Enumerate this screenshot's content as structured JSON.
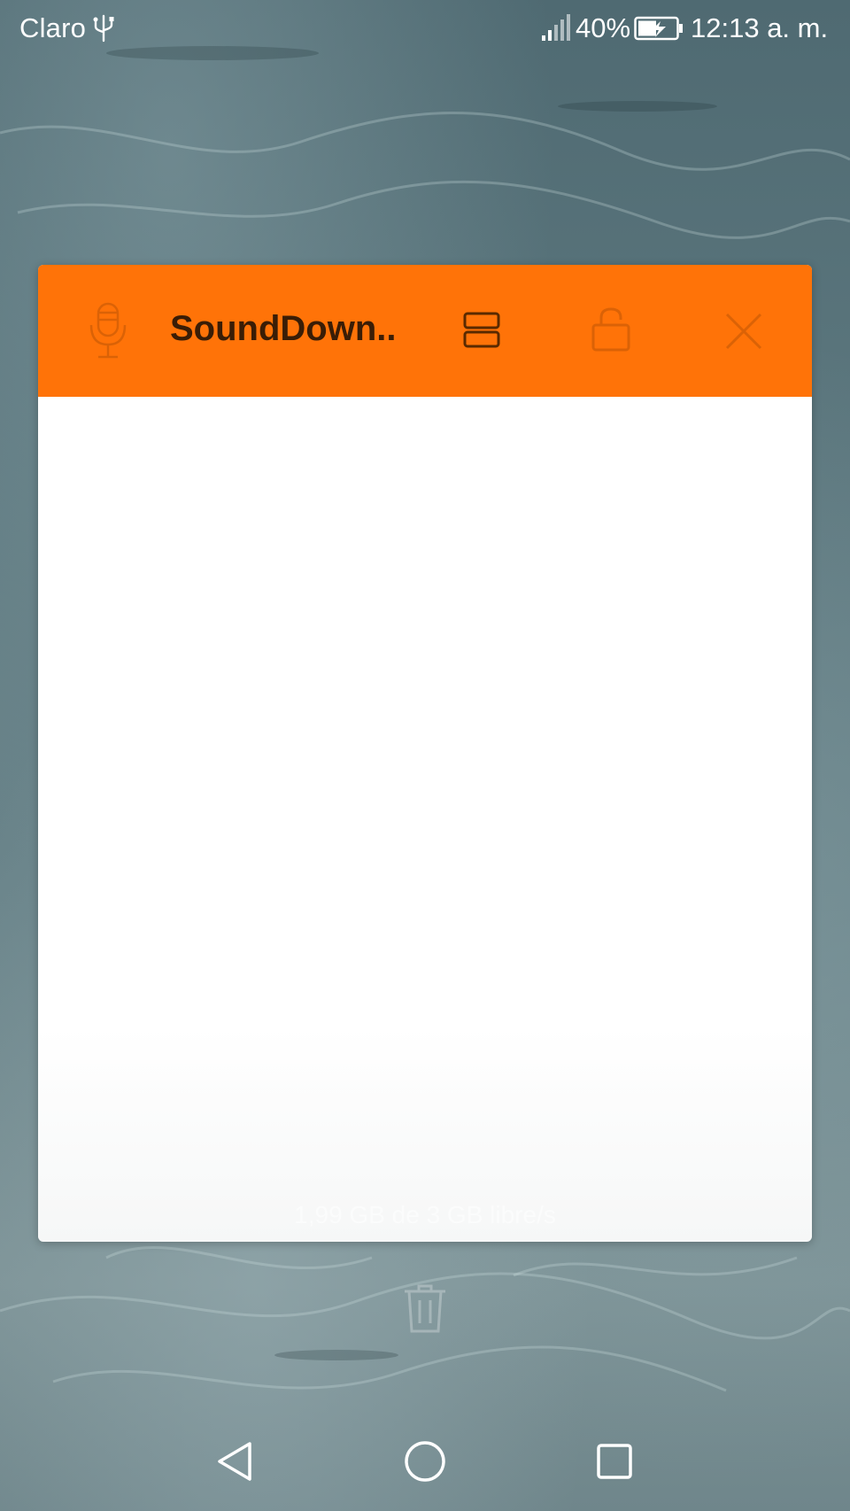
{
  "status_bar": {
    "carrier": "Claro",
    "battery_percent": "40%",
    "time": "12:13 a. m."
  },
  "app_card": {
    "title": "SoundDown..",
    "header_color": "#ff7308"
  },
  "memory": {
    "text": "1,99 GB de 3 GB libre/s"
  },
  "icons": {
    "app": "microphone-icon",
    "split": "split-screen-icon",
    "lock": "unlock-icon",
    "close": "close-icon",
    "clear": "trash-icon",
    "back": "back-icon",
    "home": "home-icon",
    "recent": "recent-apps-icon"
  }
}
